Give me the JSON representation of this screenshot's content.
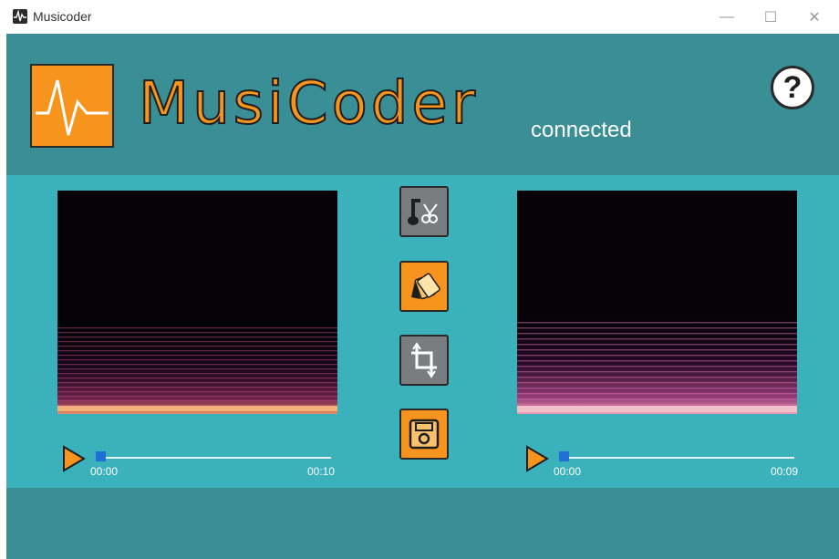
{
  "window": {
    "title": "Musicoder",
    "icon": "waveform-icon",
    "controls": {
      "minimize": "—",
      "maximize": "☐",
      "close": "✕"
    }
  },
  "header": {
    "brand": "MusiCoder",
    "status": "connected",
    "help_label": "?"
  },
  "tools": [
    {
      "name": "music-scissors-icon",
      "style": "gray"
    },
    {
      "name": "color-swatches-icon",
      "style": "orange"
    },
    {
      "name": "crop-rotate-icon",
      "style": "gray"
    },
    {
      "name": "save-disk-icon",
      "style": "orange"
    }
  ],
  "players": {
    "left": {
      "start": "00:00",
      "end": "00:10",
      "progress": 0
    },
    "right": {
      "start": "00:00",
      "end": "00:09",
      "progress": 0
    }
  },
  "colors": {
    "header_bg": "#3a8f96",
    "main_bg": "#3ab1bb",
    "accent": "#f7941d",
    "thumb": "#1f6fd6"
  }
}
